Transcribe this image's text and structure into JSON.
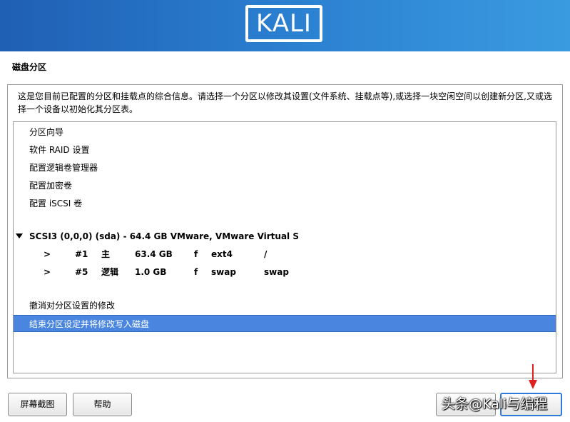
{
  "header": {
    "logo_text": "KALI",
    "brand_color": "#2b7fd0"
  },
  "page": {
    "title": "磁盘分区",
    "description": "这是您目前已配置的分区和挂载点的综合信息。请选择一个分区以修改其设置(文件系统、挂载点等),或选择一块空闲空间以创建新分区,又或选择一个设备以初始化其分区表。"
  },
  "menu_items": [
    "分区向导",
    "软件 RAID 设置",
    "配置逻辑卷管理器",
    "配置加密卷",
    "配置 iSCSI 卷"
  ],
  "disk": {
    "label": "SCSI3 (0,0,0) (sda) - 64.4 GB VMware, VMware Virtual S",
    "partitions": [
      {
        "marker": ">",
        "number": "#1",
        "type": "主",
        "size": "63.4 GB",
        "flag": "f",
        "fs": "ext4",
        "mount": "/"
      },
      {
        "marker": ">",
        "number": "#5",
        "type": "逻辑",
        "size": "1.0 GB",
        "flag": "f",
        "fs": "swap",
        "mount": "swap"
      }
    ]
  },
  "actions": {
    "undo": "撤消对分区设置的修改",
    "finish": "结束分区设定并将修改写入磁盘"
  },
  "selected_color": "#4a86e0",
  "buttons": {
    "screenshot": "屏幕截图",
    "help": "帮助",
    "continue": "继续"
  },
  "watermark": "头条@Kali与编程"
}
